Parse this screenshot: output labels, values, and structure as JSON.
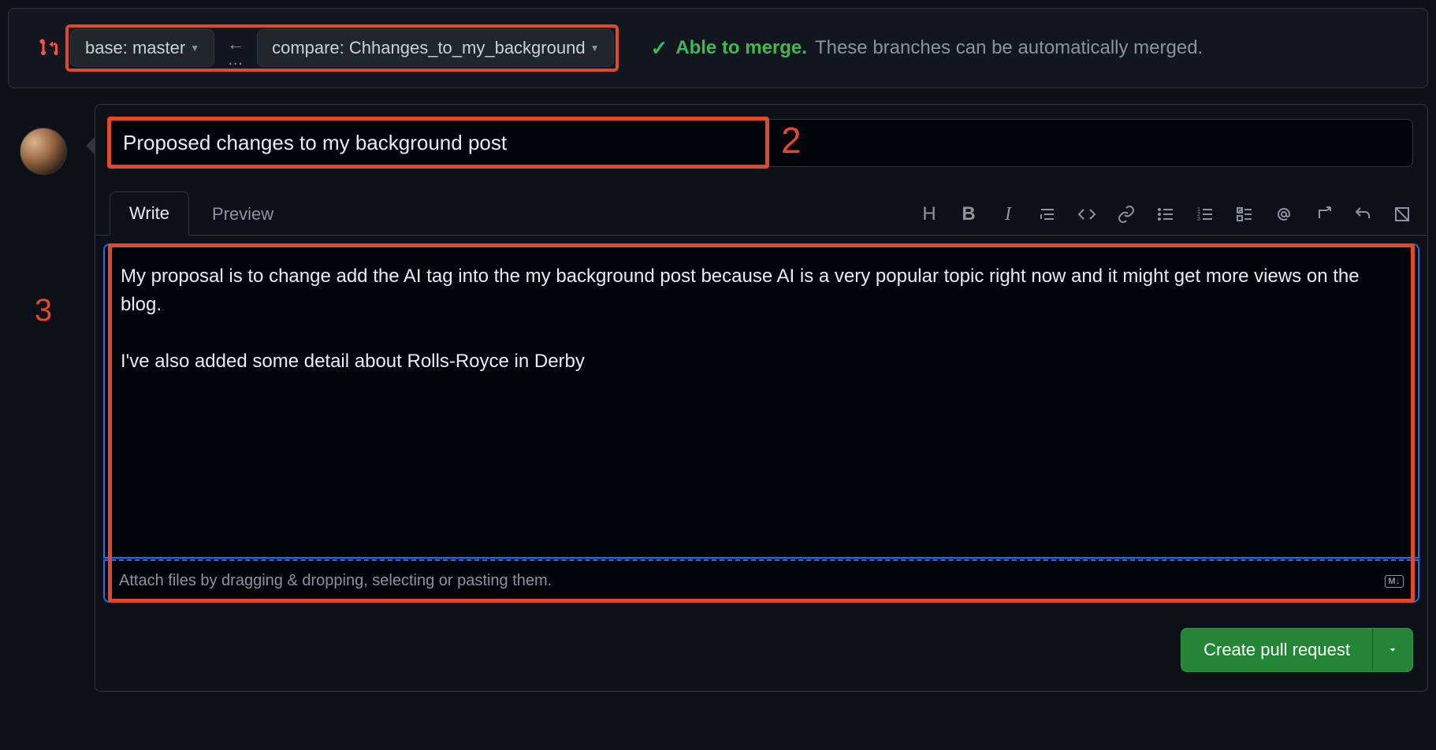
{
  "branchBar": {
    "base_label_prefix": "base: ",
    "base_branch": "master",
    "compare_label_prefix": "compare: ",
    "compare_branch": "Chhanges_to_my_background",
    "merge_able_text": "Able to merge.",
    "merge_detail_text": "These branches can be automatically merged."
  },
  "annotations": {
    "two": "2",
    "three": "3"
  },
  "compose": {
    "title_value": "Proposed changes to my background post",
    "tabs": {
      "write": "Write",
      "preview": "Preview"
    },
    "body_value": "My proposal is to change add the AI tag into the my background post because AI is a very popular topic right now and it might get more views on the blog.\n\nI've also added some detail about Rolls-Royce in Derby",
    "attach_hint": "Attach files by dragging & dropping, selecting or pasting them.",
    "md_badge": "M↓"
  },
  "actions": {
    "create_label": "Create pull request"
  },
  "toolbar_icons": {
    "heading": "H",
    "bold": "B",
    "italic": "I"
  }
}
